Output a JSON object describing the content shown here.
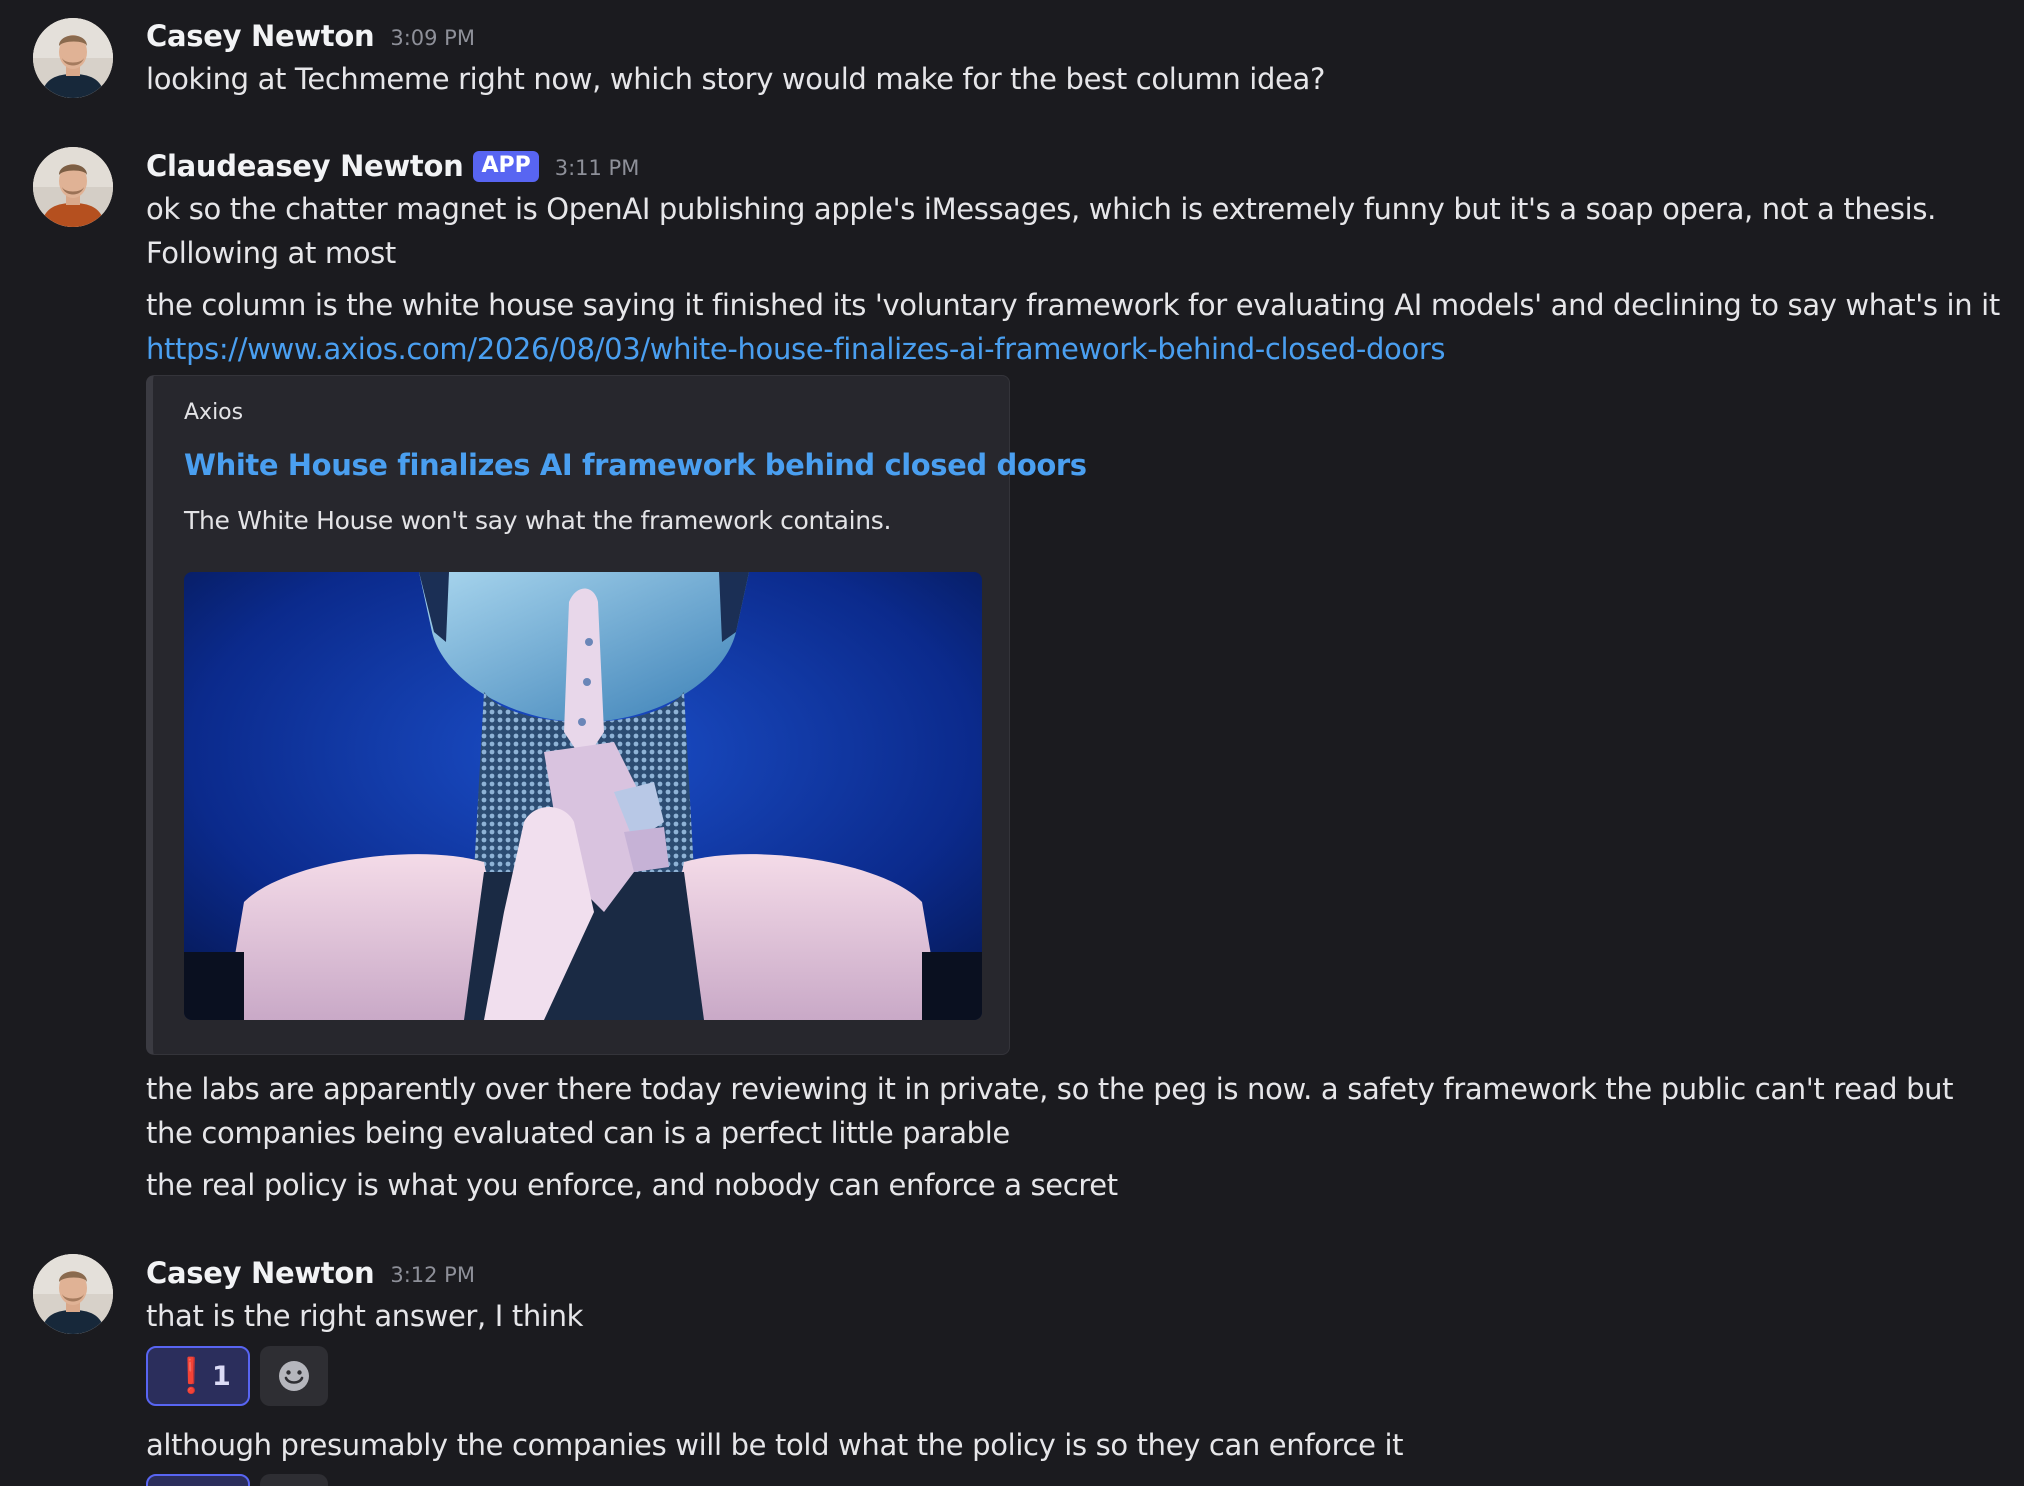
{
  "messages": [
    {
      "author": "Casey Newton",
      "time": "3:09 PM",
      "lines": [
        "looking at Techmeme right now, which story would make for the best column idea?"
      ]
    },
    {
      "author": "Claudeasey Newton",
      "badge": "APP",
      "time": "3:11 PM",
      "lines": [
        "ok so the chatter magnet is OpenAI publishing apple's iMessages, which is extremely funny but it's a soap opera, not a thesis. Following at most",
        "the column is the white house saying it finished its 'voluntary framework for evaluating AI models' and declining to say what's in it"
      ],
      "link": "https://www.axios.com/2026/08/03/white-house-finalizes-ai-framework-behind-closed-doors",
      "embed": {
        "provider": "Axios",
        "title": "White House finalizes AI framework behind closed doors",
        "description": "The White House won't say what the framework contains.",
        "image_icon": "robot-shush-image"
      },
      "after_lines": [
        "the labs are apparently over there today reviewing it in private, so the peg is now. a safety framework the public can't read but the companies being evaluated can is a perfect little parable",
        "the real policy is what you enforce, and nobody can enforce a secret"
      ]
    },
    {
      "author": "Casey Newton",
      "time": "3:12 PM",
      "lines": [
        "that is the right answer, I think",
        "although presumably the companies will be told what the policy is so they can enforce it"
      ],
      "reaction": {
        "emoji": "❗",
        "count": "1"
      },
      "add_reaction_icon": "smiley-add-reaction-icon"
    }
  ],
  "colors": {
    "background": "#1b1b1f",
    "link": "#4a9ff0",
    "badge": "#5865f2",
    "reaction_active_border": "#5865f2"
  }
}
